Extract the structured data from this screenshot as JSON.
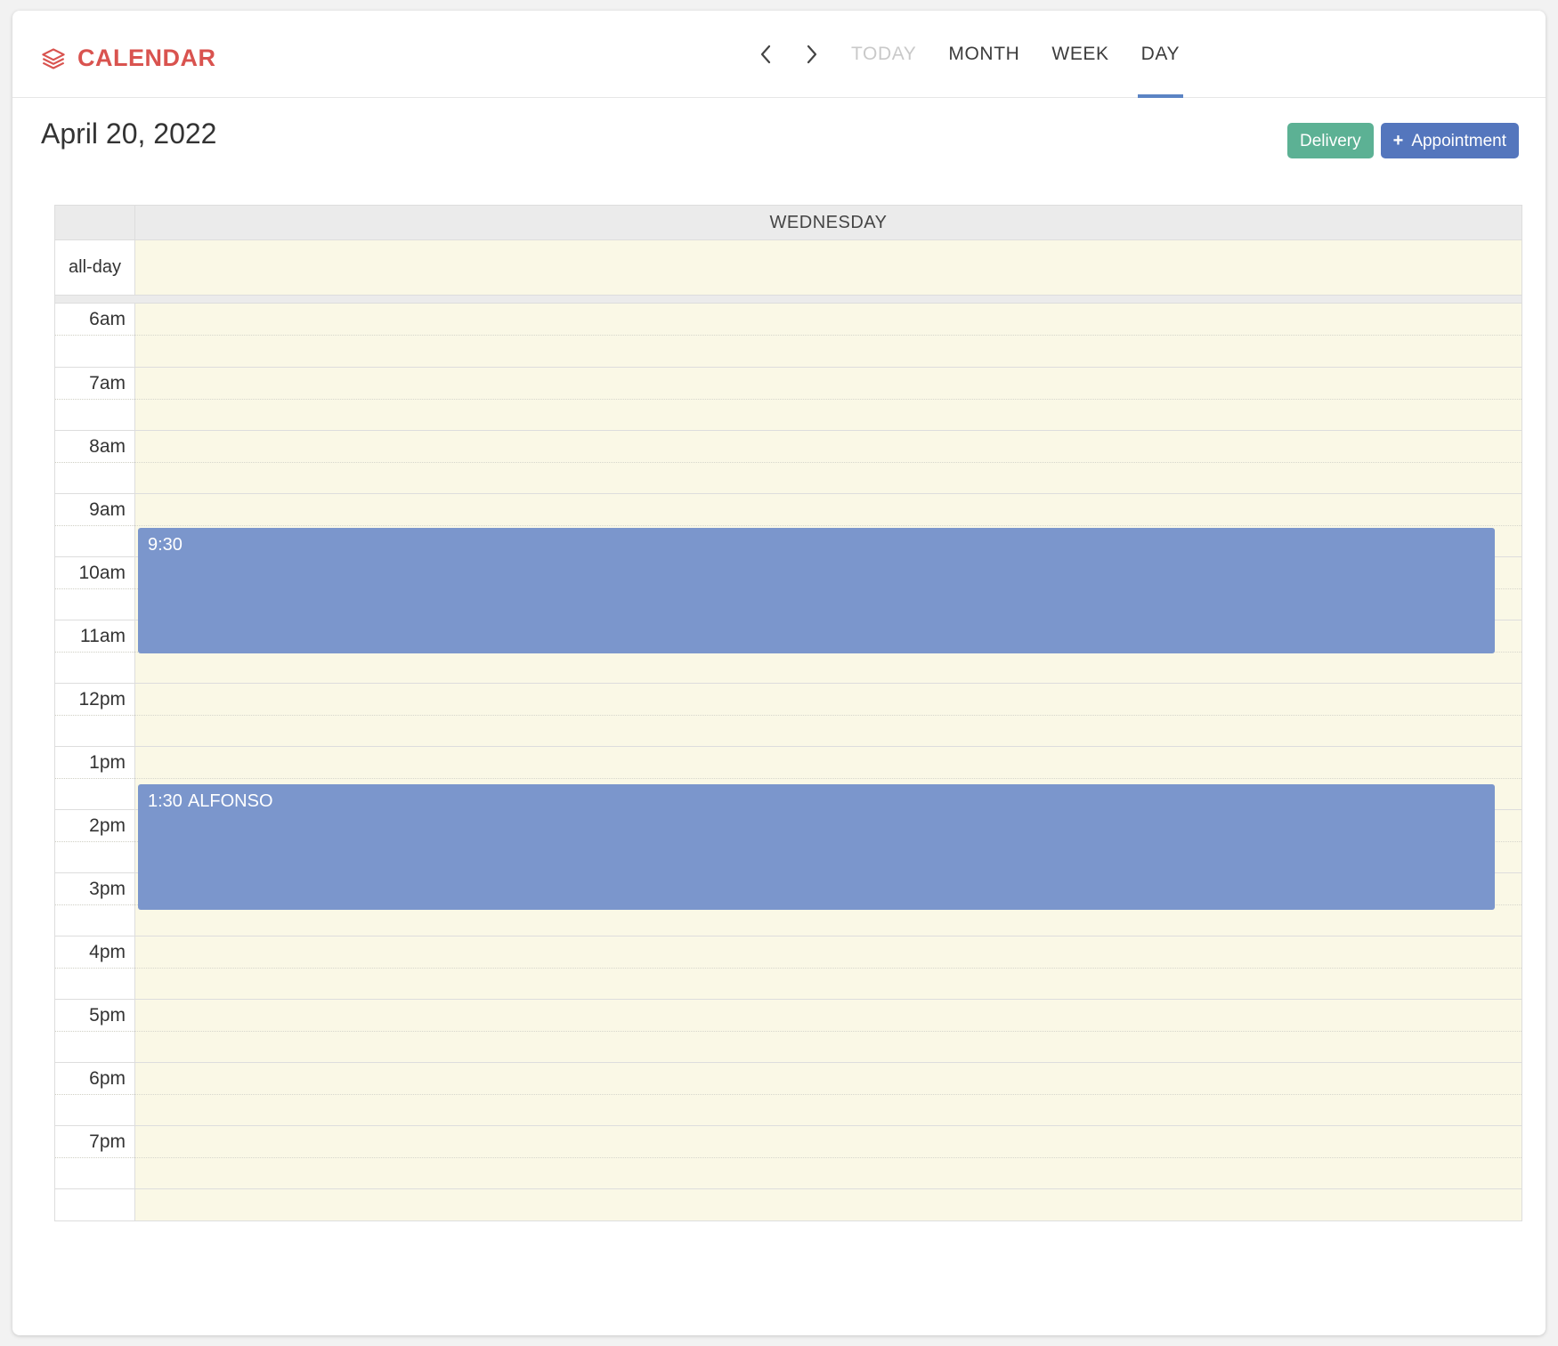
{
  "brand": {
    "icon": "layers-icon",
    "title": "CALENDAR",
    "color": "#d9534f"
  },
  "nav": {
    "prev_icon": "chevron-left-icon",
    "next_icon": "chevron-right-icon",
    "tabs": [
      {
        "label": "TODAY",
        "state": "disabled"
      },
      {
        "label": "MONTH",
        "state": "normal"
      },
      {
        "label": "WEEK",
        "state": "normal"
      },
      {
        "label": "DAY",
        "state": "active"
      }
    ],
    "active_color": "#5b84c4"
  },
  "header": {
    "page_title": "April 20, 2022",
    "delivery_button": "Delivery",
    "delivery_color": "#5cb194",
    "appointment_button": "Appointment",
    "appointment_plus": "+",
    "appointment_color": "#5476bd"
  },
  "calendar": {
    "day_header": "WEDNESDAY",
    "allday_label": "all-day",
    "grid_background": "#faf8e6",
    "header_background": "#ebebeb",
    "hours": [
      "6am",
      "7am",
      "8am",
      "9am",
      "10am",
      "11am",
      "12pm",
      "1pm",
      "2pm",
      "3pm",
      "4pm",
      "5pm",
      "6pm",
      "7pm"
    ],
    "events": [
      {
        "time": "9:30",
        "title": "",
        "start_hour_index": 3,
        "start_half": true,
        "duration_hours": 2,
        "color": "#7b96cc"
      },
      {
        "time": "1:30",
        "title": "ALFONSO",
        "start_hour_index": 7,
        "start_half": true,
        "duration_hours": 2,
        "color": "#7b96cc"
      }
    ]
  }
}
